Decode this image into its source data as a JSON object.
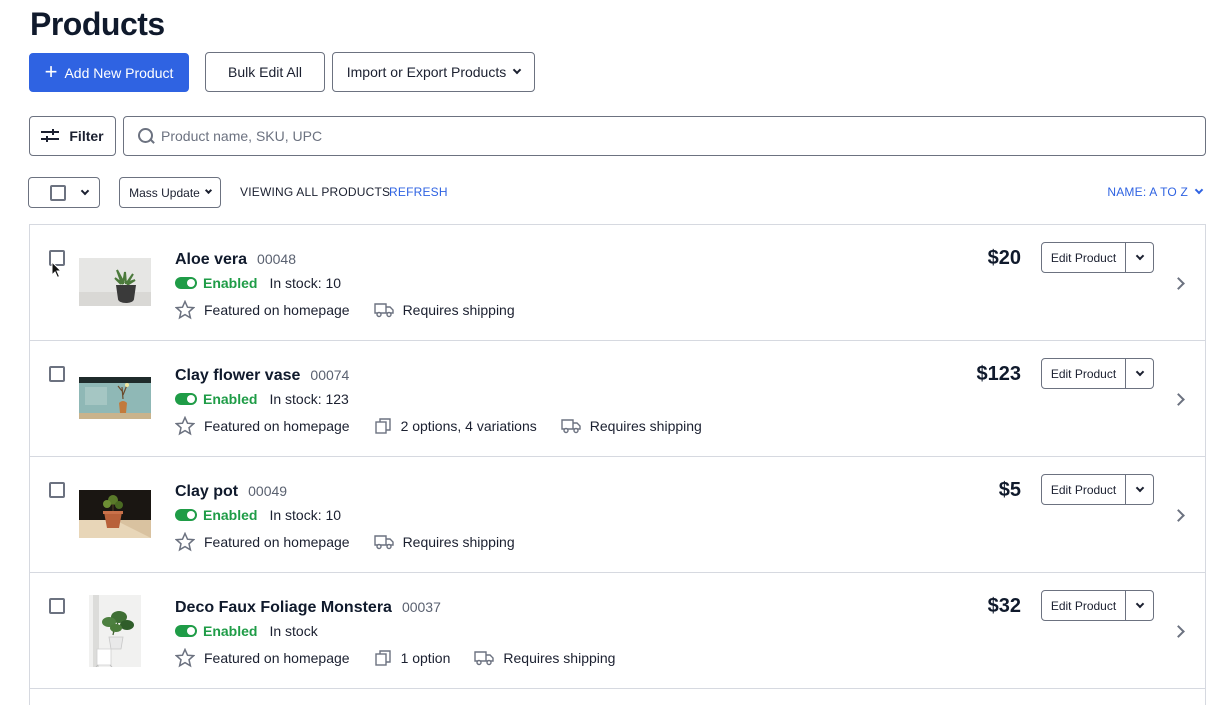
{
  "page": {
    "title": "Products"
  },
  "toolbar": {
    "add_label": "Add New Product",
    "bulk_label": "Bulk Edit All",
    "import_label": "Import or Export Products"
  },
  "filter": {
    "label": "Filter"
  },
  "search": {
    "placeholder": "Product name, SKU, UPC"
  },
  "list_controls": {
    "mass_update": "Mass Update",
    "viewing": "VIEWING ALL PRODUCTS",
    "refresh": "REFRESH",
    "sort": "NAME: A TO Z"
  },
  "colors": {
    "accent": "#2f63e2",
    "enabled": "#1f9c47"
  },
  "products": [
    {
      "name": "Aloe vera",
      "sku": "00048",
      "status": "Enabled",
      "stock": "In stock: 10",
      "featured": "Featured on homepage",
      "options": "",
      "shipping": "Requires shipping",
      "price": "$20",
      "edit": "Edit Product"
    },
    {
      "name": "Clay flower vase",
      "sku": "00074",
      "status": "Enabled",
      "stock": "In stock: 123",
      "featured": "Featured on homepage",
      "options": "2 options, 4 variations",
      "shipping": "Requires shipping",
      "price": "$123",
      "edit": "Edit Product"
    },
    {
      "name": "Clay pot",
      "sku": "00049",
      "status": "Enabled",
      "stock": "In stock: 10",
      "featured": "Featured on homepage",
      "options": "",
      "shipping": "Requires shipping",
      "price": "$5",
      "edit": "Edit Product"
    },
    {
      "name": "Deco Faux Foliage Monstera",
      "sku": "00037",
      "status": "Enabled",
      "stock": "In stock",
      "featured": "Featured on homepage",
      "options": "1 option",
      "shipping": "Requires shipping",
      "price": "$32",
      "edit": "Edit Product"
    }
  ]
}
